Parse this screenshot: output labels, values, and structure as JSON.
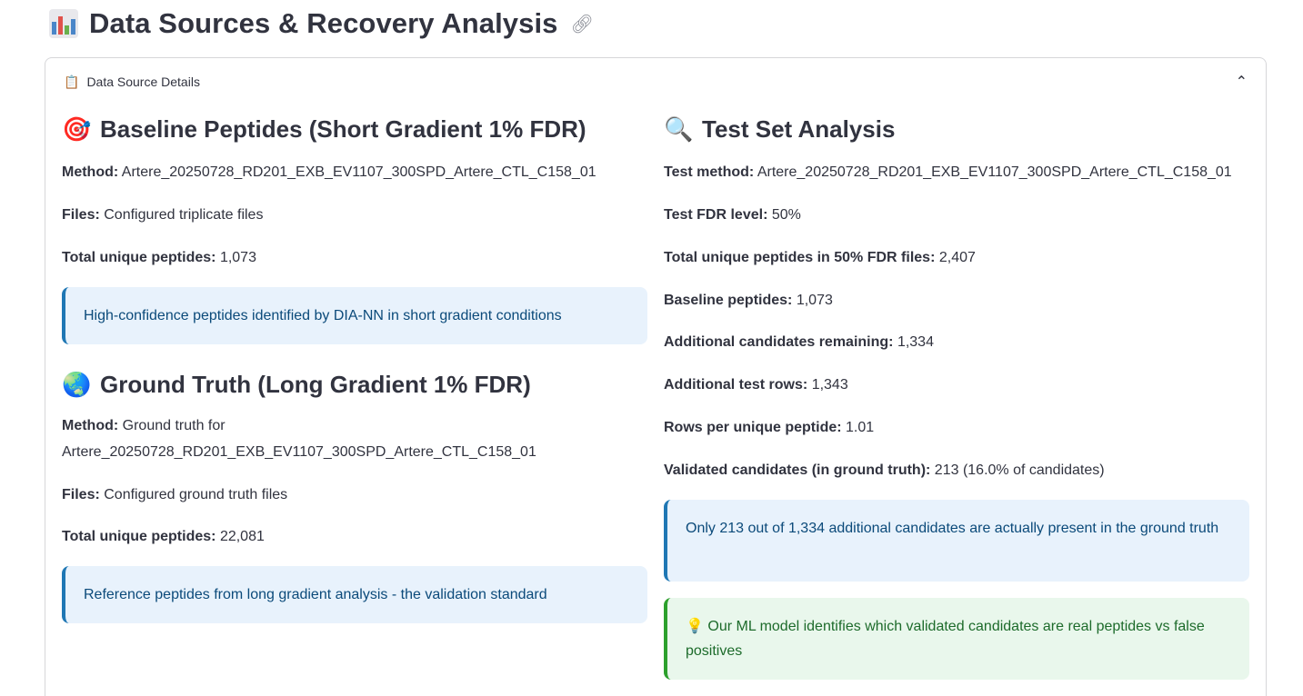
{
  "page": {
    "title": "Data Sources & Recovery Analysis",
    "title_icon": "bar-chart-icon",
    "anchor_icon": "link-icon"
  },
  "expander": {
    "icon": "clipboard-icon",
    "label": "Data Source Details",
    "chevron": "chevron-up-icon"
  },
  "baseline": {
    "icon": "target-icon",
    "title": "Baseline Peptides (Short Gradient 1% FDR)",
    "method_label": "Method:",
    "method_value": "Artere_20250728_RD201_EXB_EV1107_300SPD_Artere_CTL_C158_01",
    "files_label": "Files:",
    "files_value": "Configured triplicate files",
    "total_label": "Total unique peptides:",
    "total_value": "1,073",
    "info": "High-confidence peptides identified by DIA-NN in short gradient conditions"
  },
  "ground_truth": {
    "icon": "globe-icon",
    "title": "Ground Truth (Long Gradient 1% FDR)",
    "method_label": "Method:",
    "method_value": "Ground truth for Artere_20250728_RD201_EXB_EV1107_300SPD_Artere_CTL_C158_01",
    "files_label": "Files:",
    "files_value": "Configured ground truth files",
    "total_label": "Total unique peptides:",
    "total_value": "22,081",
    "info": "Reference peptides from long gradient analysis - the validation standard"
  },
  "test_set": {
    "icon": "magnifier-icon",
    "title": "Test Set Analysis",
    "rows": [
      {
        "label": "Test method:",
        "value": "Artere_20250728_RD201_EXB_EV1107_300SPD_Artere_CTL_C158_01"
      },
      {
        "label": "Test FDR level:",
        "value": "50%"
      },
      {
        "label": "Total unique peptides in 50% FDR files:",
        "value": "2,407"
      },
      {
        "label": "Baseline peptides:",
        "value": "1,073"
      },
      {
        "label": "Additional candidates remaining:",
        "value": "1,334"
      },
      {
        "label": "Additional test rows:",
        "value": "1,343"
      },
      {
        "label": "Rows per unique peptide:",
        "value": "1.01"
      },
      {
        "label": "Validated candidates (in ground truth):",
        "value": "213 (16.0% of candidates)"
      }
    ],
    "info": "Only 213 out of 1,334 additional candidates are actually present in the ground truth",
    "success_icon": "lightbulb-icon",
    "success": "Our ML model identifies which validated candidates are real peptides vs false positives"
  },
  "colors": {
    "info_bg": "#e8f2fc",
    "info_border": "#1f77b4",
    "info_text": "#0b4a7a",
    "success_bg": "#e9f7ec",
    "success_border": "#2ca02c",
    "success_text": "#1d6b2b"
  }
}
